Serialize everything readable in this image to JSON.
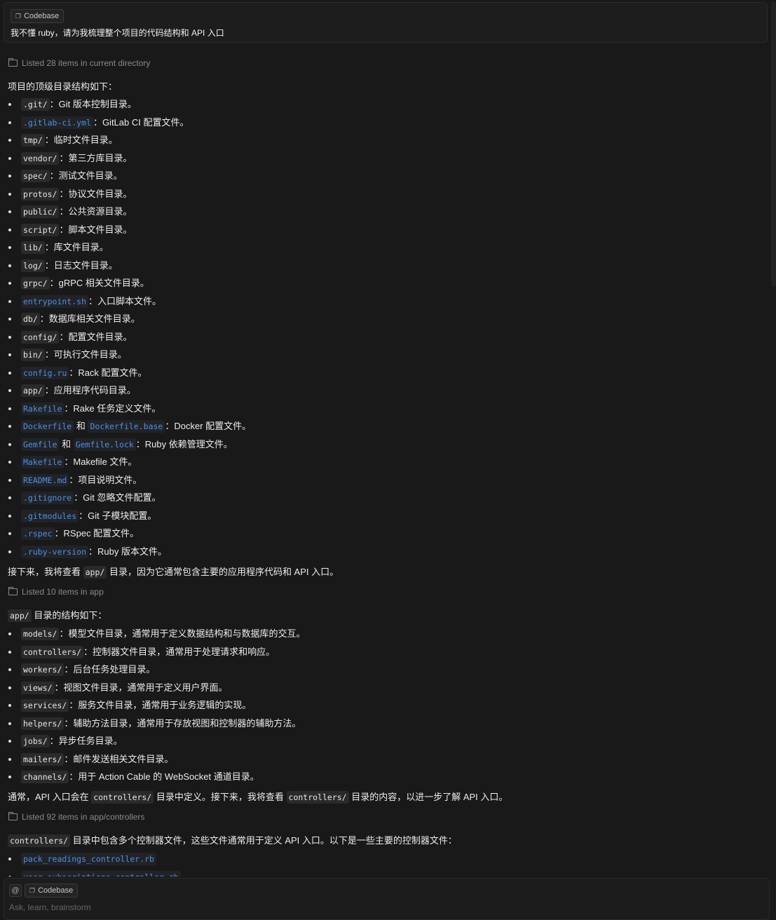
{
  "prompt": {
    "chip_label": "Codebase",
    "text": "我不懂 ruby，请为我梳理整个项目的代码结构和 API 入口"
  },
  "tools": [
    "Listed 28 items in current directory",
    "Listed 10 items in app",
    "Listed 92 items in app/controllers"
  ],
  "intro_top": "项目的顶级目录结构如下：",
  "top_items": [
    {
      "parts": [
        {
          "code": ".git/"
        },
        {
          "text": "：Git 版本控制目录。"
        }
      ]
    },
    {
      "parts": [
        {
          "file": ".gitlab-ci.yml"
        },
        {
          "text": "：GitLab CI 配置文件。"
        }
      ]
    },
    {
      "parts": [
        {
          "code": "tmp/"
        },
        {
          "text": "：临时文件目录。"
        }
      ]
    },
    {
      "parts": [
        {
          "code": "vendor/"
        },
        {
          "text": "：第三方库目录。"
        }
      ]
    },
    {
      "parts": [
        {
          "code": "spec/"
        },
        {
          "text": "：测试文件目录。"
        }
      ]
    },
    {
      "parts": [
        {
          "code": "protos/"
        },
        {
          "text": "：协议文件目录。"
        }
      ]
    },
    {
      "parts": [
        {
          "code": "public/"
        },
        {
          "text": "：公共资源目录。"
        }
      ]
    },
    {
      "parts": [
        {
          "code": "script/"
        },
        {
          "text": "：脚本文件目录。"
        }
      ]
    },
    {
      "parts": [
        {
          "code": "lib/"
        },
        {
          "text": "：库文件目录。"
        }
      ]
    },
    {
      "parts": [
        {
          "code": "log/"
        },
        {
          "text": "：日志文件目录。"
        }
      ]
    },
    {
      "parts": [
        {
          "code": "grpc/"
        },
        {
          "text": "：gRPC 相关文件目录。"
        }
      ]
    },
    {
      "parts": [
        {
          "file": "entrypoint.sh"
        },
        {
          "text": "：入口脚本文件。"
        }
      ]
    },
    {
      "parts": [
        {
          "code": "db/"
        },
        {
          "text": "：数据库相关文件目录。"
        }
      ]
    },
    {
      "parts": [
        {
          "code": "config/"
        },
        {
          "text": "：配置文件目录。"
        }
      ]
    },
    {
      "parts": [
        {
          "code": "bin/"
        },
        {
          "text": "：可执行文件目录。"
        }
      ]
    },
    {
      "parts": [
        {
          "file": "config.ru"
        },
        {
          "text": "：Rack 配置文件。"
        }
      ]
    },
    {
      "parts": [
        {
          "code": "app/"
        },
        {
          "text": "：应用程序代码目录。"
        }
      ]
    },
    {
      "parts": [
        {
          "file": "Rakefile"
        },
        {
          "text": "：Rake 任务定义文件。"
        }
      ]
    },
    {
      "parts": [
        {
          "file": "Dockerfile"
        },
        {
          "text": " 和 "
        },
        {
          "file": "Dockerfile.base"
        },
        {
          "text": "：Docker 配置文件。"
        }
      ]
    },
    {
      "parts": [
        {
          "file": "Gemfile"
        },
        {
          "text": " 和 "
        },
        {
          "file": "Gemfile.lock"
        },
        {
          "text": "：Ruby 依赖管理文件。"
        }
      ]
    },
    {
      "parts": [
        {
          "file": "Makefile"
        },
        {
          "text": "：Makefile 文件。"
        }
      ]
    },
    {
      "parts": [
        {
          "file": "README.md"
        },
        {
          "text": "：项目说明文件。"
        }
      ]
    },
    {
      "parts": [
        {
          "file": ".gitignore"
        },
        {
          "text": "：Git 忽略文件配置。"
        }
      ]
    },
    {
      "parts": [
        {
          "file": ".gitmodules"
        },
        {
          "text": "：Git 子模块配置。"
        }
      ]
    },
    {
      "parts": [
        {
          "file": ".rspec"
        },
        {
          "text": "：RSpec 配置文件。"
        }
      ]
    },
    {
      "parts": [
        {
          "file": ".ruby-version"
        },
        {
          "text": "：Ruby 版本文件。"
        }
      ]
    }
  ],
  "next_app": [
    {
      "text": "接下来，我将查看 "
    },
    {
      "code": "app/"
    },
    {
      "text": " 目录，因为它通常包含主要的应用程序代码和 API 入口。"
    }
  ],
  "intro_app": [
    {
      "code": "app/"
    },
    {
      "text": " 目录的结构如下："
    }
  ],
  "app_items": [
    {
      "parts": [
        {
          "code": "models/"
        },
        {
          "text": "：模型文件目录，通常用于定义数据结构和与数据库的交互。"
        }
      ]
    },
    {
      "parts": [
        {
          "code": "controllers/"
        },
        {
          "text": "：控制器文件目录，通常用于处理请求和响应。"
        }
      ]
    },
    {
      "parts": [
        {
          "code": "workers/"
        },
        {
          "text": "：后台任务处理目录。"
        }
      ]
    },
    {
      "parts": [
        {
          "code": "views/"
        },
        {
          "text": "：视图文件目录，通常用于定义用户界面。"
        }
      ]
    },
    {
      "parts": [
        {
          "code": "services/"
        },
        {
          "text": "：服务文件目录，通常用于业务逻辑的实现。"
        }
      ]
    },
    {
      "parts": [
        {
          "code": "helpers/"
        },
        {
          "text": "：辅助方法目录，通常用于存放视图和控制器的辅助方法。"
        }
      ]
    },
    {
      "parts": [
        {
          "code": "jobs/"
        },
        {
          "text": "：异步任务目录。"
        }
      ]
    },
    {
      "parts": [
        {
          "code": "mailers/"
        },
        {
          "text": "：邮件发送相关文件目录。"
        }
      ]
    },
    {
      "parts": [
        {
          "code": "channels/"
        },
        {
          "text": "：用于 Action Cable 的 WebSocket 通道目录。"
        }
      ]
    }
  ],
  "next_ctrl": [
    {
      "text": "通常，API 入口会在 "
    },
    {
      "code": "controllers/"
    },
    {
      "text": " 目录中定义。接下来，我将查看 "
    },
    {
      "code": "controllers/"
    },
    {
      "text": " 目录的内容，以进一步了解 API 入口。"
    }
  ],
  "intro_ctrl": [
    {
      "code": "controllers/"
    },
    {
      "text": " 目录中包含多个控制器文件，这些文件通常用于定义 API 入口。以下是一些主要的控制器文件："
    }
  ],
  "ctrl_items": [
    {
      "parts": [
        {
          "file": "pack_readings_controller.rb"
        }
      ]
    },
    {
      "parts": [
        {
          "file": "user_subscriptions_controller.rb"
        }
      ]
    }
  ],
  "composer": {
    "at": "@",
    "chip_label": "Codebase",
    "placeholder": "Ask, learn, brainstorm"
  }
}
